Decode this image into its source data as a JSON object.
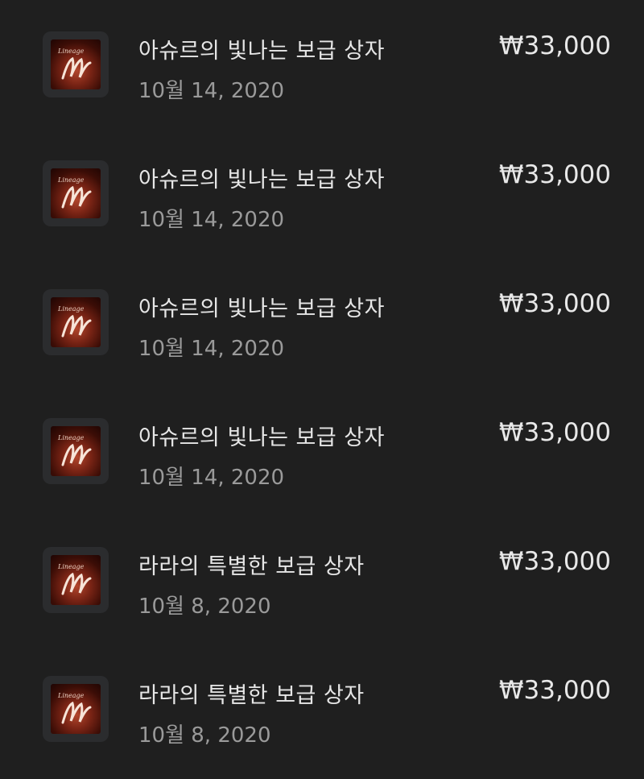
{
  "purchases": [
    {
      "title": "아슈르의 빛나는 보급 상자",
      "date": "10월 14, 2020",
      "price": "₩33,000",
      "icon": "lineage-m-app-icon",
      "logo_text": "Lineage"
    },
    {
      "title": "아슈르의 빛나는 보급 상자",
      "date": "10월 14, 2020",
      "price": "₩33,000",
      "icon": "lineage-m-app-icon",
      "logo_text": "Lineage"
    },
    {
      "title": "아슈르의 빛나는 보급 상자",
      "date": "10월 14, 2020",
      "price": "₩33,000",
      "icon": "lineage-m-app-icon",
      "logo_text": "Lineage"
    },
    {
      "title": "아슈르의 빛나는 보급 상자",
      "date": "10월 14, 2020",
      "price": "₩33,000",
      "icon": "lineage-m-app-icon",
      "logo_text": "Lineage"
    },
    {
      "title": "라라의 특별한 보급 상자",
      "date": "10월 8, 2020",
      "price": "₩33,000",
      "icon": "lineage-m-app-icon",
      "logo_text": "Lineage"
    },
    {
      "title": "라라의 특별한 보급 상자",
      "date": "10월 8, 2020",
      "price": "₩33,000",
      "icon": "lineage-m-app-icon",
      "logo_text": "Lineage"
    }
  ],
  "colors": {
    "background": "#1f1f1f",
    "title_text": "#e6e6e6",
    "date_text": "#9a9a9a",
    "price_text": "#e8e8e8"
  }
}
